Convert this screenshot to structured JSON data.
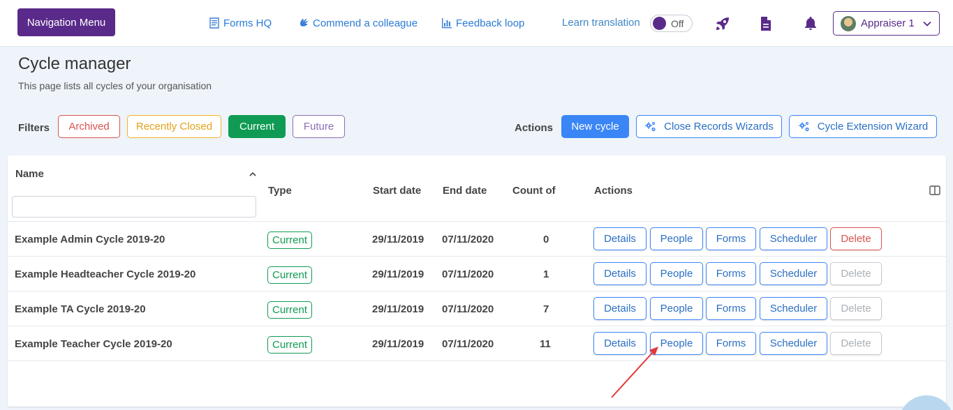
{
  "nav": {
    "menu_label": "Navigation Menu",
    "links": [
      {
        "label": "Forms HQ",
        "icon": "form-icon"
      },
      {
        "label": "Commend a colleague",
        "icon": "hand-wave-icon"
      },
      {
        "label": "Feedback loop",
        "icon": "bar-chart-icon"
      }
    ],
    "learn_translation": "Learn translation",
    "toggle_label": "Off",
    "icons": [
      "rocket-icon",
      "document-icon",
      "bell-icon"
    ],
    "user_name": "Appraiser 1"
  },
  "page": {
    "title": "Cycle manager",
    "subtitle": "This page lists all cycles of your organisation"
  },
  "filters": {
    "label": "Filters",
    "items": [
      "Archived",
      "Recently Closed",
      "Current",
      "Future"
    ],
    "active": "Current"
  },
  "actions": {
    "label": "Actions",
    "new_cycle": "New cycle",
    "close_records": "Close Records Wizards",
    "cycle_extension": "Cycle Extension Wizard"
  },
  "table": {
    "columns": [
      "Name",
      "Type",
      "Start date",
      "End date",
      "Count of",
      "Actions"
    ],
    "name_filter_placeholder": "",
    "row_actions": [
      "Details",
      "People",
      "Forms",
      "Scheduler",
      "Delete"
    ],
    "rows": [
      {
        "name": "Example Admin Cycle 2019-20",
        "type": "Current",
        "start": "29/11/2019",
        "end": "07/11/2020",
        "count": "0",
        "delete_enabled": true
      },
      {
        "name": "Example Headteacher Cycle 2019-20",
        "type": "Current",
        "start": "29/11/2019",
        "end": "07/11/2020",
        "count": "1",
        "delete_enabled": false
      },
      {
        "name": "Example TA Cycle 2019-20",
        "type": "Current",
        "start": "29/11/2019",
        "end": "07/11/2020",
        "count": "7",
        "delete_enabled": false
      },
      {
        "name": "Example Teacher Cycle 2019-20",
        "type": "Current",
        "start": "29/11/2019",
        "end": "07/11/2020",
        "count": "11",
        "delete_enabled": false
      }
    ]
  },
  "colors": {
    "brand": "#5a2a8a",
    "primary": "#3b86f7",
    "success": "#0f9b53",
    "danger": "#d9534f",
    "annotation_arrow": "#e0393e"
  }
}
